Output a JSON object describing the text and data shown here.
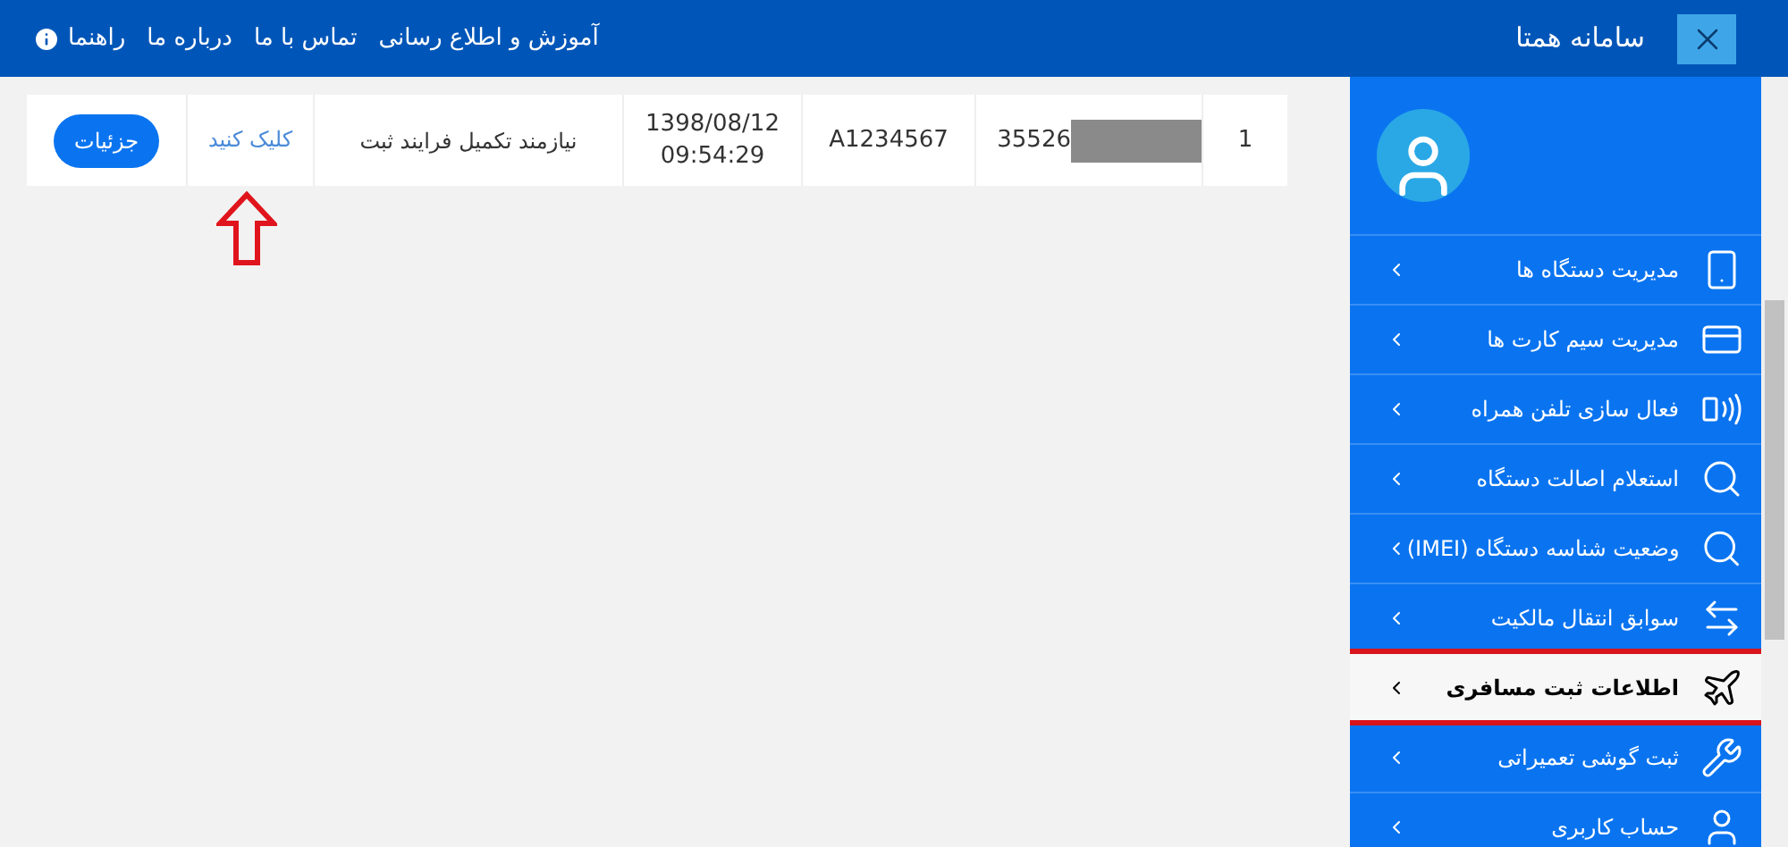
{
  "header": {
    "title": "سامانه همتا",
    "links": [
      {
        "label": "آموزش و اطلاع رسانی"
      },
      {
        "label": "تماس با ما"
      },
      {
        "label": "درباره ما"
      },
      {
        "label": "راهنما"
      }
    ]
  },
  "table": {
    "rows": [
      {
        "index": "1",
        "serial": "35526",
        "code": "A1234567",
        "date": "1398/08/12",
        "time": "09:54:29",
        "status": "نیازمند تکمیل فرایند ثبت",
        "link": "کلیک کنید",
        "button": "جزئیات"
      }
    ]
  },
  "sidebar": {
    "items": [
      {
        "label": "مدیریت دستگاه ها",
        "selected": false
      },
      {
        "label": "مدیریت سیم کارت ها",
        "selected": false
      },
      {
        "label": "فعال سازی تلفن همراه",
        "selected": false
      },
      {
        "label": "استعلام اصالت دستگاه",
        "selected": false
      },
      {
        "label": "وضعیت شناسه دستگاه (IMEI)",
        "selected": false
      },
      {
        "label": "سوابق انتقال مالکیت",
        "selected": false
      },
      {
        "label": "اطلاعات ثبت مسافری",
        "selected": true
      },
      {
        "label": "ثبت گوشی تعمیراتی",
        "selected": false
      },
      {
        "label": "حساب کاربری",
        "selected": false
      }
    ]
  }
}
